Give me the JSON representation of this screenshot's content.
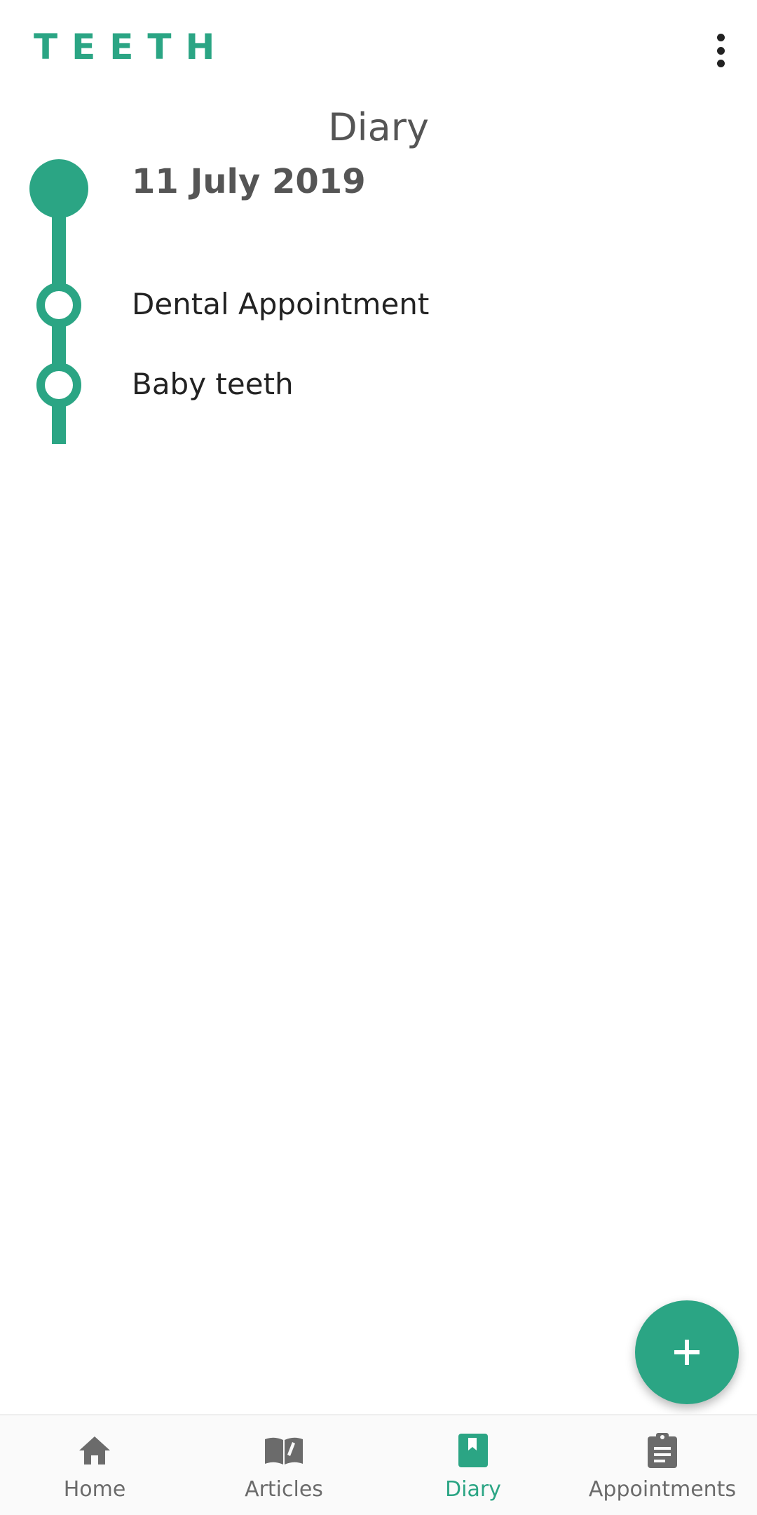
{
  "app_bar": {
    "logo": "TEETH",
    "menu_icon": "more-vert-icon"
  },
  "page": {
    "title": "Diary"
  },
  "timeline": {
    "date": "11 July 2019",
    "entries": [
      {
        "label": "Dental Appointment"
      },
      {
        "label": "Baby teeth"
      }
    ]
  },
  "fab": {
    "icon": "plus-icon"
  },
  "bottom_nav": {
    "items": [
      {
        "label": "Home",
        "icon": "home-icon",
        "active": false
      },
      {
        "label": "Articles",
        "icon": "book-open-icon",
        "active": false
      },
      {
        "label": "Diary",
        "icon": "bookmark-book-icon",
        "active": true
      },
      {
        "label": "Appointments",
        "icon": "clipboard-icon",
        "active": false
      }
    ]
  },
  "colors": {
    "accent": "#2ba584",
    "text_dark": "#222222",
    "text_gray": "#555555",
    "nav_inactive": "#6b6b6b"
  }
}
